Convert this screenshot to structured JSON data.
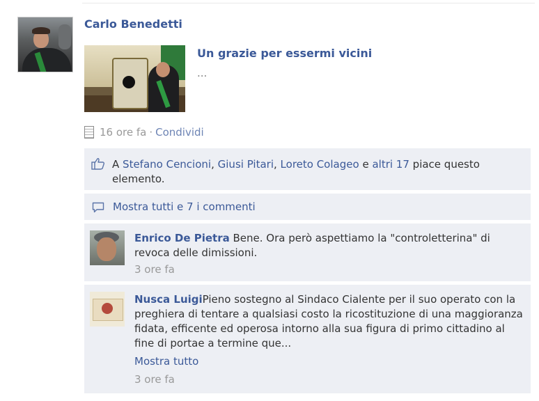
{
  "post": {
    "author": "Carlo Benedetti",
    "link_title": "Un grazie per essermi vicini",
    "link_excerpt": "...",
    "time": "16 ore fa",
    "separator": "·",
    "share_label": "Condividi"
  },
  "likes": {
    "prefix": "A",
    "names": [
      "Stefano Cencioni",
      "Giusi Pitari",
      "Loreto Colageo"
    ],
    "sep1": ",",
    "sep2": ",",
    "conj": "e",
    "others": "altri 17",
    "suffix": "piace questo elemento."
  },
  "show_all_comments": "Mostra tutti e 7 i commenti",
  "comments": [
    {
      "author": "Enrico De Pietra",
      "text": "Bene. Ora però aspettiamo la \"controletterina\" di revoca delle dimissioni.",
      "time": "3 ore fa"
    },
    {
      "author": "Nusca Luigi",
      "text": "Pieno sostegno al Sindaco Cialente per il suo operato con la preghiera di tentare a qualsiasi costo la ricostituzione di una maggioranza fidata, efficente ed operosa intorno alla sua figura di primo cittadino al fine di portae a termine que...",
      "show_more": "Mostra tutto",
      "time": "3 ore fa"
    }
  ],
  "colors": {
    "link": "#3b5998",
    "muted": "#999999",
    "panel": "#edeff4"
  },
  "icons": {
    "note": "note-icon",
    "like": "thumbs-up-icon",
    "comment": "comment-bubble-icon"
  }
}
